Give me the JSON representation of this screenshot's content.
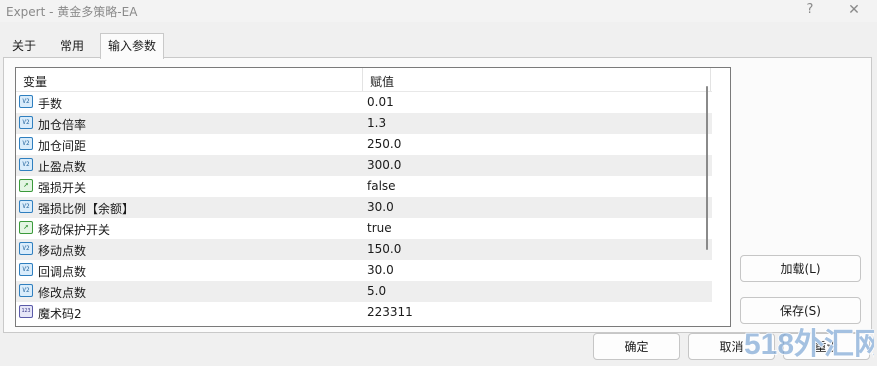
{
  "window": {
    "title": "Expert - 黄金多策略-EA",
    "help_label": "?",
    "close_label": "✕"
  },
  "tabs": [
    {
      "label": "关于"
    },
    {
      "label": "常用"
    },
    {
      "label": "输入参数",
      "active": true
    }
  ],
  "grid": {
    "columns": {
      "name": "变量",
      "value": "赋值"
    },
    "rows": [
      {
        "icon": "double-value-icon",
        "name": "手数",
        "value": "0.01"
      },
      {
        "icon": "double-value-icon",
        "name": "加仓倍率",
        "value": "1.3"
      },
      {
        "icon": "double-value-icon",
        "name": "加仓间距",
        "value": "250.0"
      },
      {
        "icon": "double-value-icon",
        "name": "止盈点数",
        "value": "300.0"
      },
      {
        "icon": "bool-value-icon",
        "name": "强损开关",
        "value": "false"
      },
      {
        "icon": "double-value-icon",
        "name": "强损比例【余额】",
        "value": "30.0"
      },
      {
        "icon": "bool-value-icon",
        "name": "移动保护开关",
        "value": "true"
      },
      {
        "icon": "double-value-icon",
        "name": "移动点数",
        "value": "150.0"
      },
      {
        "icon": "double-value-icon",
        "name": "回调点数",
        "value": "30.0"
      },
      {
        "icon": "double-value-icon",
        "name": "修改点数",
        "value": "5.0"
      },
      {
        "icon": "int-value-icon",
        "name": "魔术码2",
        "value": "223311"
      }
    ]
  },
  "icon_glyphs": {
    "double-value-icon": "V2",
    "bool-value-icon": "↗",
    "int-value-icon": "123"
  },
  "buttons": {
    "load": "加载(L)",
    "save": "保存(S)",
    "ok": "确定",
    "cancel": "取消",
    "reset": "重设"
  },
  "watermark": {
    "text": "518外汇网"
  },
  "colors": {
    "accent": "#2f7fbf",
    "watermark": "#5a8ec9"
  }
}
